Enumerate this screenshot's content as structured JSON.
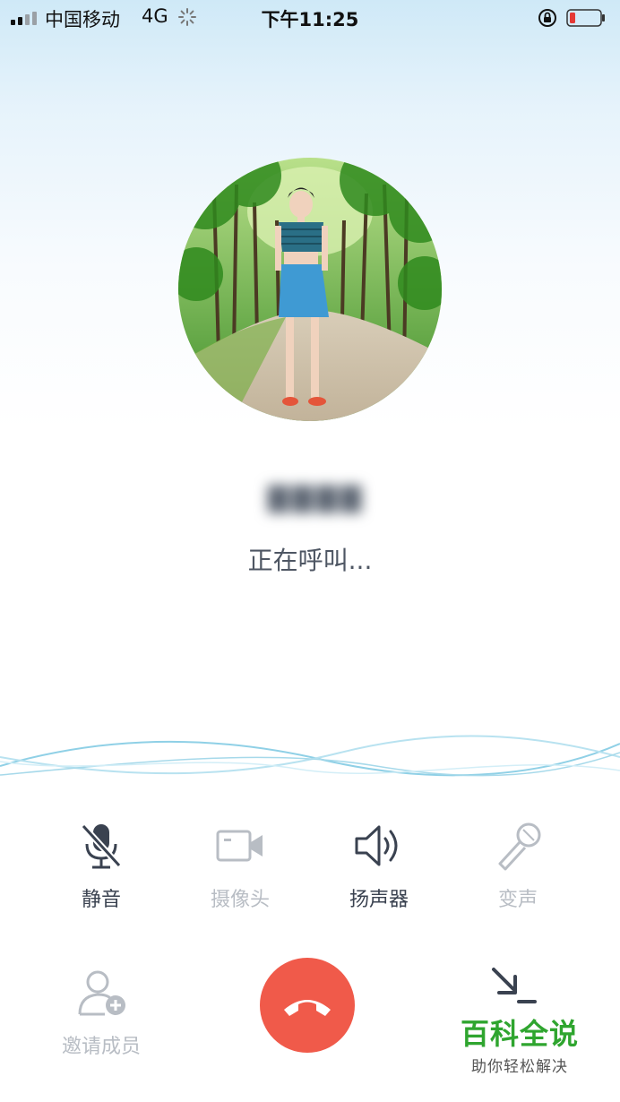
{
  "status_bar": {
    "carrier": "中国移动",
    "network": "4G",
    "time": "下午11:25"
  },
  "callee": {
    "name_blurred": "▇▇▇▇",
    "status": "正在呼叫..."
  },
  "controls": {
    "mute": {
      "label": "静音",
      "icon": "mic-off-icon"
    },
    "camera": {
      "label": "摄像头",
      "icon": "video-camera-icon"
    },
    "speaker": {
      "label": "扬声器",
      "icon": "speaker-icon"
    },
    "voice_change": {
      "label": "变声",
      "icon": "microphone-icon"
    },
    "invite": {
      "label": "邀请成员",
      "icon": "add-user-icon"
    },
    "hangup": {
      "icon": "hangup-icon"
    },
    "minimize": {
      "icon": "minimize-icon"
    }
  },
  "watermark": {
    "title": "百科全说",
    "subtitle": "助你轻松解决"
  },
  "colors": {
    "hangup": "#f05a4a",
    "active": "#3a4250",
    "disabled": "#b8bdc4",
    "watermark": "#2fa52f"
  }
}
